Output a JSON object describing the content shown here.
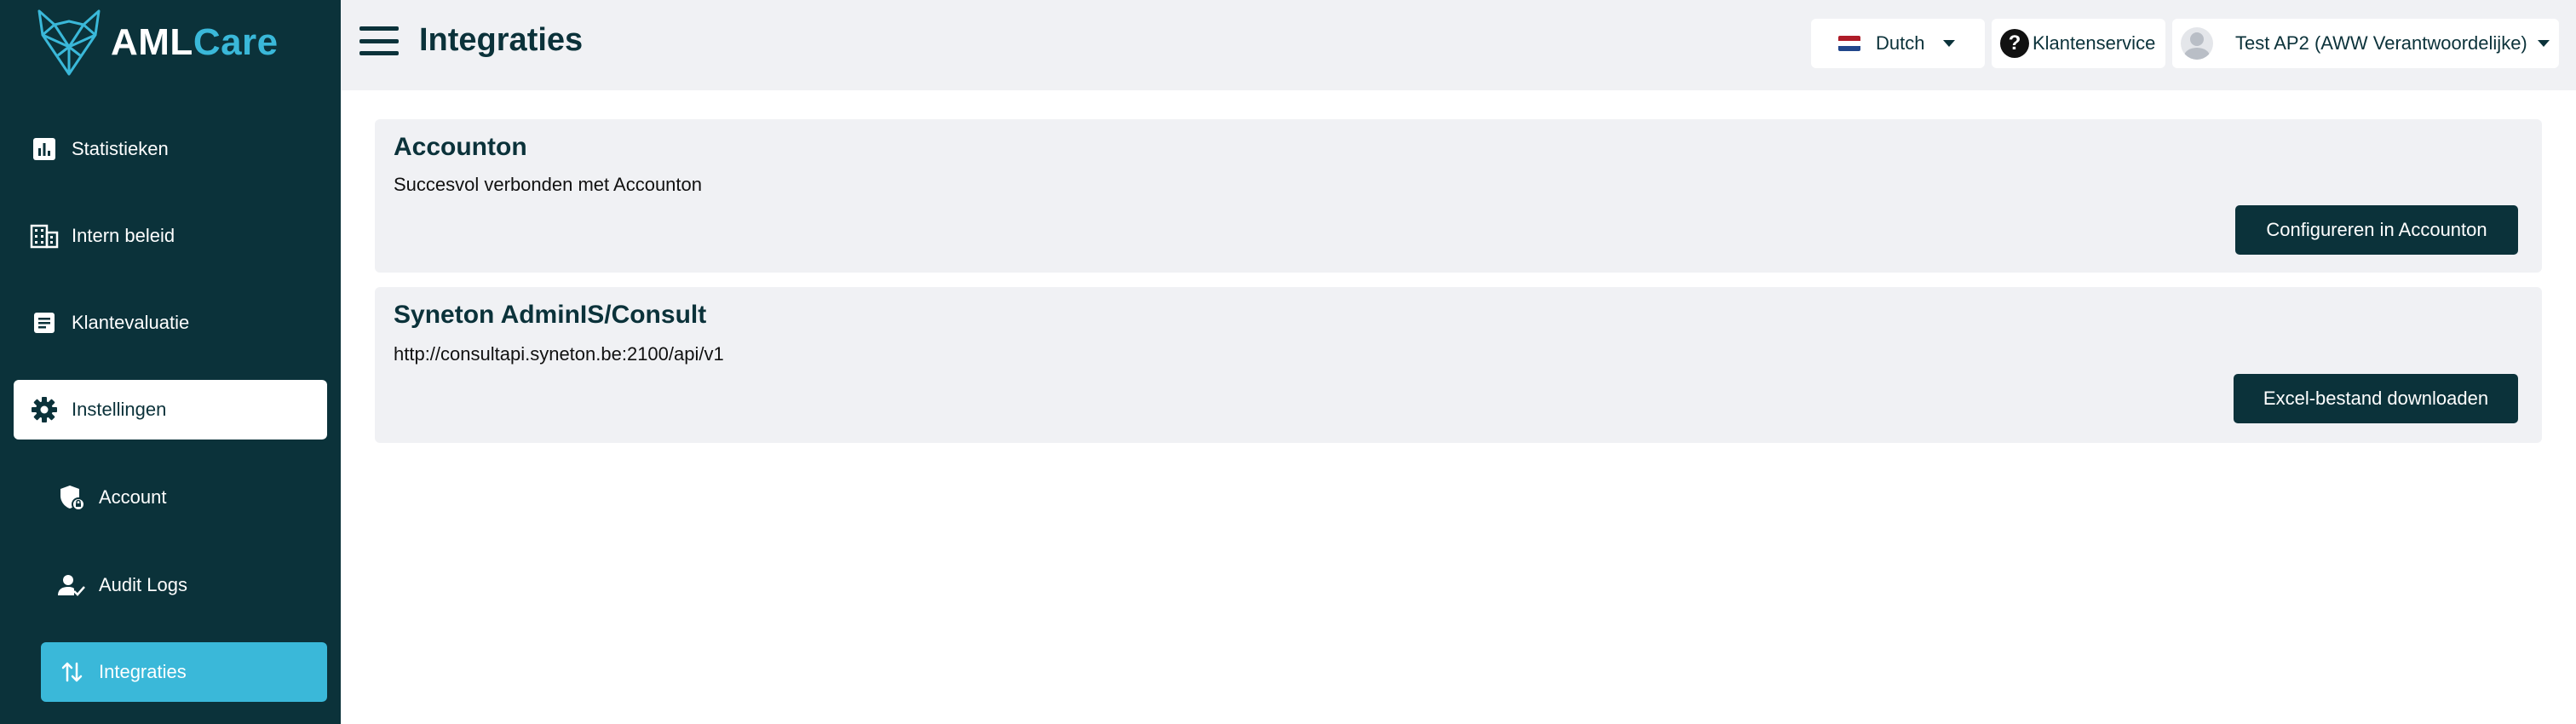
{
  "brand": {
    "name_part1": "AML",
    "name_part2": "Care"
  },
  "sidebar": {
    "items": [
      {
        "label": "Statistieken",
        "icon": "bar-chart-icon"
      },
      {
        "label": "Intern beleid",
        "icon": "building-icon"
      },
      {
        "label": "Klantevaluatie",
        "icon": "document-icon"
      },
      {
        "label": "Instellingen",
        "icon": "gear-icon"
      },
      {
        "label": "Account",
        "icon": "shield-lock-icon"
      },
      {
        "label": "Audit Logs",
        "icon": "user-check-icon"
      },
      {
        "label": "Integraties",
        "icon": "swap-arrows-icon"
      }
    ]
  },
  "header": {
    "title": "Integraties",
    "language": "Dutch",
    "support": "Klantenservice",
    "user": "Test AP2 (AWW Verantwoordelijke)"
  },
  "cards": [
    {
      "title": "Accounton",
      "text": "Succesvol verbonden met Accounton",
      "button": "Configureren in Accounton"
    },
    {
      "title": "Syneton AdminIS/Consult",
      "text": "http://consultapi.syneton.be:2100/api/v1",
      "button": "Excel-bestand downloaden"
    }
  ],
  "colors": {
    "sidebar": "#0b323a",
    "accent": "#3ab8d9",
    "panel": "#f0f1f4"
  }
}
